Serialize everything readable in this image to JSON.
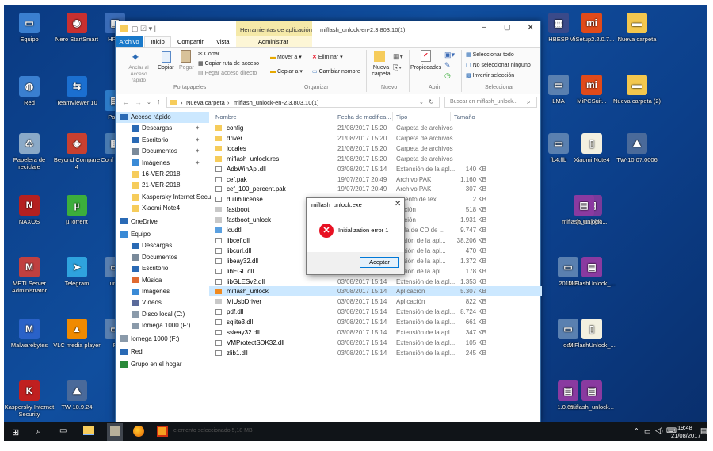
{
  "desktop": {
    "icons": [
      {
        "label": "Equipo",
        "color": "#3a7fd0",
        "glyph": "▭"
      },
      {
        "label": "Nero StartSmart",
        "color": "#c83030",
        "glyph": "◉"
      },
      {
        "label": "HP D",
        "color": "#3a6cb8",
        "glyph": "▣"
      },
      {
        "label": "Red",
        "color": "#3a7fd0",
        "glyph": "◍"
      },
      {
        "label": "TeamViewer 10",
        "color": "#1b6fd0",
        "glyph": "⇆"
      },
      {
        "label": "Partit",
        "color": "#2d7bc8",
        "glyph": "▤"
      },
      {
        "label": "Papelera de reciclaje",
        "color": "#8aa9c8",
        "glyph": "♺"
      },
      {
        "label": "Beyond Compare 4",
        "color": "#c84030",
        "glyph": "◈"
      },
      {
        "label": "Conf Naxo",
        "color": "#4a7bb0",
        "glyph": "▦"
      },
      {
        "label": "NAXOS",
        "color": "#b42020",
        "glyph": "N"
      },
      {
        "label": "µTorrent",
        "color": "#3cae3c",
        "glyph": "µ"
      },
      {
        "label": "METI Server Administrator",
        "color": "#c04040",
        "glyph": "M"
      },
      {
        "label": "Telegram",
        "color": "#2fa3de",
        "glyph": "➤"
      },
      {
        "label": "una",
        "color": "#5a80b0",
        "glyph": "▭"
      },
      {
        "label": "Malwarebytes",
        "color": "#2a62c8",
        "glyph": "M"
      },
      {
        "label": "VLC media player",
        "color": "#f08a00",
        "glyph": "▲"
      },
      {
        "label": "F",
        "color": "#5a80b0",
        "glyph": "▭"
      },
      {
        "label": "Kaspersky Internet Security",
        "color": "#c02020",
        "glyph": "K"
      },
      {
        "label": "TW-10.9.24",
        "color": "#4a6a9a",
        "glyph": "⛰"
      },
      {
        "label": "MiSetup2.2.0.7...",
        "color": "#e04a1a",
        "glyph": "mi"
      },
      {
        "label": "Nueva carpeta",
        "color": "#f3c74e",
        "glyph": "▬"
      },
      {
        "label": "HBESP",
        "color": "#3a4a8a",
        "glyph": "▦"
      },
      {
        "label": "MiPCSuit...",
        "color": "#e04a1a",
        "glyph": "mi"
      },
      {
        "label": "Nueva carpeta (2)",
        "color": "#f3c74e",
        "glyph": "▬"
      },
      {
        "label": "LMA",
        "color": "#5a80b0",
        "glyph": "▭"
      },
      {
        "label": "Xiaomi Note4",
        "color": "#f3f0e0",
        "glyph": "▯"
      },
      {
        "label": "TW-10.07.0006",
        "color": "#4a6a9a",
        "glyph": "⛰"
      },
      {
        "label": "fb4.flb",
        "color": "#5a80b0",
        "glyph": "▭"
      },
      {
        "label": "[6.0.1] [zh...",
        "color": "#7a3a9a",
        "glyph": "▤"
      },
      {
        "label": "miflash_unlock...",
        "color": "#8a3aa0",
        "glyph": "▤"
      },
      {
        "label": "2016-2",
        "color": "#5a80b0",
        "glyph": "▭"
      },
      {
        "label": "MiFlashUnlock_...",
        "color": "#8a3aa0",
        "glyph": "▤"
      },
      {
        "label": "ock",
        "color": "#5a80b0",
        "glyph": "▭"
      },
      {
        "label": "MiFlashUnlock_...",
        "color": "#f3f0e0",
        "glyph": "▯"
      },
      {
        "label": "1.0.65...",
        "color": "#8a3aa0",
        "glyph": "▤"
      },
      {
        "label": "miflash_unlock...",
        "color": "#8a3aa0",
        "glyph": "▤"
      }
    ]
  },
  "window": {
    "title": "miflash_unlock-en-2.3.803.10(1)",
    "context_tab": "Herramientas de aplicación",
    "tabs": [
      "Archivo",
      "Inicio",
      "Compartir",
      "Vista",
      "Administrar"
    ],
    "ribbon": {
      "pin_label": "Anclar al Acceso rápido",
      "copy_label": "Copiar",
      "paste_label": "Pegar",
      "cut_label": "Cortar",
      "copy_path_label": "Copiar ruta de acceso",
      "paste_shortcut_label": "Pegar acceso directo",
      "group_clipboard": "Portapapeles",
      "move_to": "Mover a",
      "copy_to": "Copiar a",
      "delete": "Eliminar",
      "rename": "Cambiar nombre",
      "group_organize": "Organizar",
      "new_folder": "Nueva carpeta",
      "group_new": "Nuevo",
      "properties": "Propiedades",
      "group_open": "Abrir",
      "select_all": "Seleccionar todo",
      "select_none": "No seleccionar ninguno",
      "invert_selection": "Invertir selección",
      "group_select": "Seleccionar"
    },
    "breadcrumb": [
      "Nueva carpeta",
      "miflash_unlock-en-2.3.803.10(1)"
    ],
    "search_placeholder": "Buscar en miflash_unlock...",
    "nav": [
      {
        "label": "Acceso rápido",
        "icon": "star",
        "level": 0,
        "selected": true
      },
      {
        "label": "Descargas",
        "icon": "download",
        "level": 1,
        "pin": true
      },
      {
        "label": "Escritorio",
        "icon": "desktop",
        "level": 1,
        "pin": true
      },
      {
        "label": "Documentos",
        "icon": "doc",
        "level": 1,
        "pin": true
      },
      {
        "label": "Imágenes",
        "icon": "image",
        "level": 1,
        "pin": true
      },
      {
        "label": "16-VER-2018",
        "icon": "folder",
        "level": 1
      },
      {
        "label": "21-VER-2018",
        "icon": "folder",
        "level": 1
      },
      {
        "label": "Kaspersky Internet Secu",
        "icon": "folder",
        "level": 1
      },
      {
        "label": "Xiaomi Note4",
        "icon": "folder",
        "level": 1
      },
      {
        "label": "OneDrive",
        "icon": "cloud",
        "level": 0
      },
      {
        "label": "Equipo",
        "icon": "pc",
        "level": 0
      },
      {
        "label": "Descargas",
        "icon": "download",
        "level": 1
      },
      {
        "label": "Documentos",
        "icon": "doc",
        "level": 1
      },
      {
        "label": "Escritorio",
        "icon": "desktop",
        "level": 1
      },
      {
        "label": "Música",
        "icon": "music",
        "level": 1
      },
      {
        "label": "Imágenes",
        "icon": "image",
        "level": 1
      },
      {
        "label": "Vídeos",
        "icon": "video",
        "level": 1
      },
      {
        "label": "Disco local (C:)",
        "icon": "drive",
        "level": 1
      },
      {
        "label": "Iomega 1000 (F:)",
        "icon": "drive",
        "level": 1
      },
      {
        "label": "Iomega 1000 (F:)",
        "icon": "drive",
        "level": 0
      },
      {
        "label": "Red",
        "icon": "network",
        "level": 0
      },
      {
        "label": "Grupo en el hogar",
        "icon": "homegroup",
        "level": 0
      }
    ],
    "columns": [
      "Nombre",
      "Fecha de modifica...",
      "Tipo",
      "Tamaño"
    ],
    "files": [
      {
        "name": "config",
        "date": "21/08/2017 15:20",
        "type": "Carpeta de archivos",
        "size": "",
        "kind": "folder"
      },
      {
        "name": "driver",
        "date": "21/08/2017 15:20",
        "type": "Carpeta de archivos",
        "size": "",
        "kind": "folder"
      },
      {
        "name": "locales",
        "date": "21/08/2017 15:20",
        "type": "Carpeta de archivos",
        "size": "",
        "kind": "folder"
      },
      {
        "name": "miflash_unlock.res",
        "date": "21/08/2017 15:20",
        "type": "Carpeta de archivos",
        "size": "",
        "kind": "folder"
      },
      {
        "name": "AdbWinApi.dll",
        "date": "03/08/2017 15:14",
        "type": "Extensión de la apl...",
        "size": "140 KB",
        "kind": "file"
      },
      {
        "name": "cef.pak",
        "date": "19/07/2017 20:49",
        "type": "Archivo PAK",
        "size": "1.160 KB",
        "kind": "file"
      },
      {
        "name": "cef_100_percent.pak",
        "date": "19/07/2017 20:49",
        "type": "Archivo PAK",
        "size": "307 KB",
        "kind": "file"
      },
      {
        "name": "duilib license",
        "date": "",
        "type": "umento de tex...",
        "size": "2 KB",
        "kind": "file"
      },
      {
        "name": "fastboot",
        "date": "",
        "type": "icación",
        "size": "518 KB",
        "kind": "app"
      },
      {
        "name": "fastboot_unlock",
        "date": "",
        "type": "icación",
        "size": "1.931 KB",
        "kind": "app"
      },
      {
        "name": "icudtl",
        "date": "",
        "type": "icula de CD de ...",
        "size": "9.747 KB",
        "kind": "disc"
      },
      {
        "name": "libcef.dll",
        "date": "",
        "type": "ensión de la apl...",
        "size": "38.206 KB",
        "kind": "file"
      },
      {
        "name": "libcurl.dll",
        "date": "",
        "type": "ensión de la apl...",
        "size": "470 KB",
        "kind": "file"
      },
      {
        "name": "libeay32.dll",
        "date": "",
        "type": "ensión de la apl...",
        "size": "1.372 KB",
        "kind": "file"
      },
      {
        "name": "libEGL.dll",
        "date": "",
        "type": "ensión de la apl...",
        "size": "178 KB",
        "kind": "file"
      },
      {
        "name": "libGLESv2.dll",
        "date": "03/08/2017 15:14",
        "type": "Extensión de la apl...",
        "size": "1.353 KB",
        "kind": "file"
      },
      {
        "name": "miflash_unlock",
        "date": "03/08/2017 15:14",
        "type": "Aplicación",
        "size": "5.307 KB",
        "kind": "appsel",
        "selected": true
      },
      {
        "name": "MiUsbDriver",
        "date": "03/08/2017 15:14",
        "type": "Aplicación",
        "size": "822 KB",
        "kind": "app"
      },
      {
        "name": "pdf.dll",
        "date": "03/08/2017 15:14",
        "type": "Extensión de la apl...",
        "size": "8.724 KB",
        "kind": "file"
      },
      {
        "name": "sqlite3.dll",
        "date": "03/08/2017 15:14",
        "type": "Extensión de la apl...",
        "size": "661 KB",
        "kind": "file"
      },
      {
        "name": "ssleay32.dll",
        "date": "03/08/2017 15:14",
        "type": "Extensión de la apl...",
        "size": "347 KB",
        "kind": "file"
      },
      {
        "name": "VMProtectSDK32.dll",
        "date": "03/08/2017 15:14",
        "type": "Extensión de la apl...",
        "size": "105 KB",
        "kind": "file"
      },
      {
        "name": "zlib1.dll",
        "date": "03/08/2017 15:14",
        "type": "Extensión de la apl...",
        "size": "245 KB",
        "kind": "file"
      }
    ],
    "status_text": "elemento seleccionado 5,18 MB"
  },
  "dialog": {
    "title": "miflash_unlock.exe",
    "message": "Initialization error 1",
    "button": "Aceptar",
    "icon": "error-icon"
  },
  "taskbar": {
    "time": "19:48",
    "date": "21/08/2017"
  },
  "colors": {
    "accent": "#1979ca",
    "selected_row": "#cce8ff",
    "error": "#e81123",
    "context_tab": "#f5e9a8"
  }
}
